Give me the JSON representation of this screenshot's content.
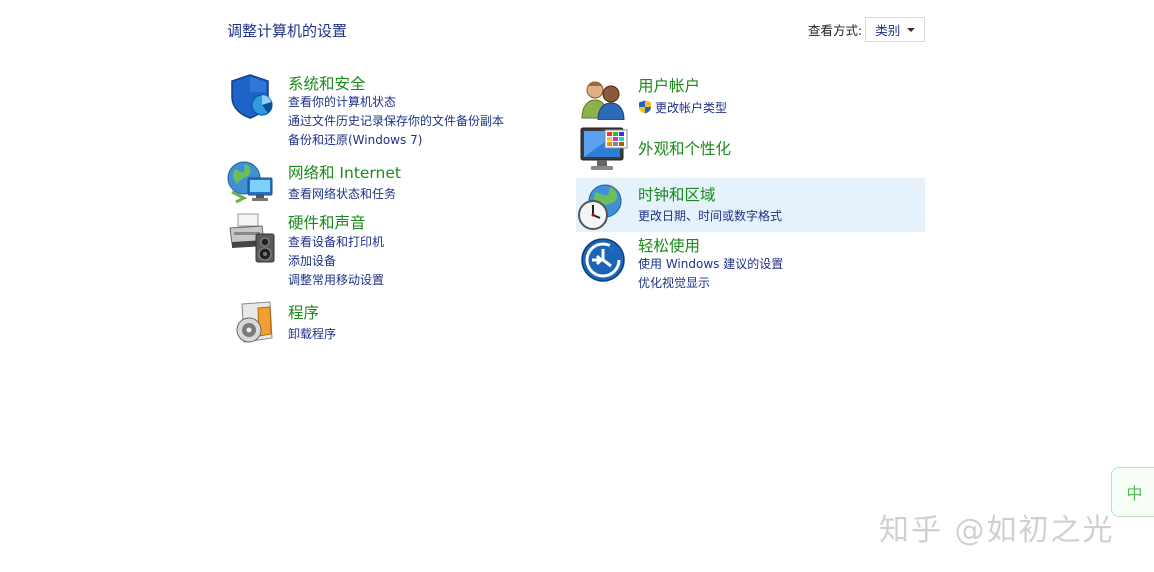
{
  "header": {
    "title": "调整计算机的设置",
    "view_by_label": "查看方式:",
    "view_by_value": "类别"
  },
  "categories": {
    "system_security": {
      "title": "系统和安全",
      "links": [
        "查看你的计算机状态",
        "通过文件历史记录保存你的文件备份副本",
        "备份和还原(Windows 7)"
      ]
    },
    "network": {
      "title": "网络和 Internet",
      "links": [
        "查看网络状态和任务"
      ]
    },
    "hardware": {
      "title": "硬件和声音",
      "links": [
        "查看设备和打印机",
        "添加设备",
        "调整常用移动设置"
      ]
    },
    "programs": {
      "title": "程序",
      "links": [
        "卸载程序"
      ]
    },
    "user_accounts": {
      "title": "用户帐户",
      "links": [
        "更改帐户类型"
      ]
    },
    "appearance": {
      "title": "外观和个性化",
      "links": []
    },
    "clock_region": {
      "title": "时钟和区域",
      "links": [
        "更改日期、时间或数字格式"
      ]
    },
    "ease_of_access": {
      "title": "轻松使用",
      "links": [
        "使用 Windows 建议的设置",
        "优化视觉显示"
      ]
    }
  },
  "side_tab": {
    "label": "中"
  },
  "watermark": "知乎 @如初之光",
  "colors": {
    "category_title": "#1a8a1a",
    "link": "#1e3287",
    "hover_highlight": "#e5f1fb"
  }
}
